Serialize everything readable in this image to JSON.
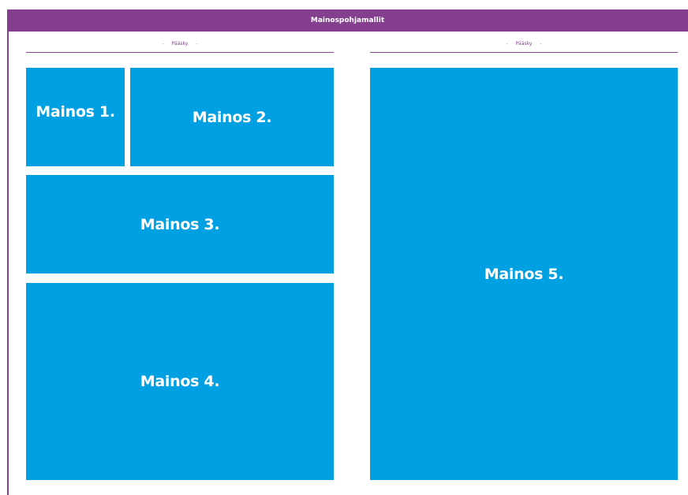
{
  "header": {
    "title": "Mainospohjamallit"
  },
  "columns": [
    {
      "label": "Pääsky",
      "separator": "-"
    },
    {
      "label": "Pääsky",
      "separator": "-"
    }
  ],
  "ads": [
    {
      "label": "Mainos 1."
    },
    {
      "label": "Mainos 2."
    },
    {
      "label": "Mainos 3."
    },
    {
      "label": "Mainos 4."
    },
    {
      "label": "Mainos 5."
    }
  ],
  "colors": {
    "accent": "#843f8e",
    "ad_fill": "#00a0e3",
    "text_on_ad": "#ffffff"
  }
}
